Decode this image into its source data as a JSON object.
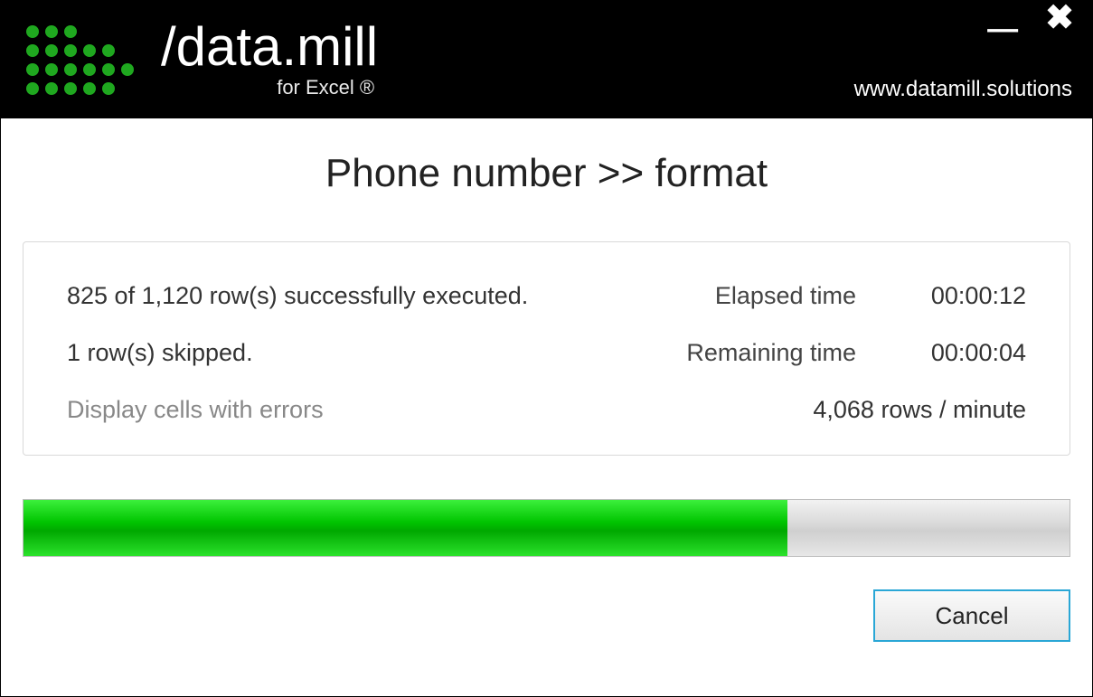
{
  "brand": {
    "prefix": "/data.",
    "suffix": "mill",
    "tagline": "for Excel ®"
  },
  "website": "www.datamill.solutions",
  "title": "Phone number >> format",
  "status": {
    "executed": "825 of 1,120 row(s) successfully executed.",
    "skipped": "1 row(s) skipped.",
    "errors_link": "Display cells with errors",
    "elapsed_label": "Elapsed time",
    "elapsed_value": "00:00:12",
    "remaining_label": "Remaining time",
    "remaining_value": "00:00:04",
    "rate": "4,068 rows / minute"
  },
  "progress": {
    "percent": 73
  },
  "buttons": {
    "cancel": "Cancel"
  }
}
